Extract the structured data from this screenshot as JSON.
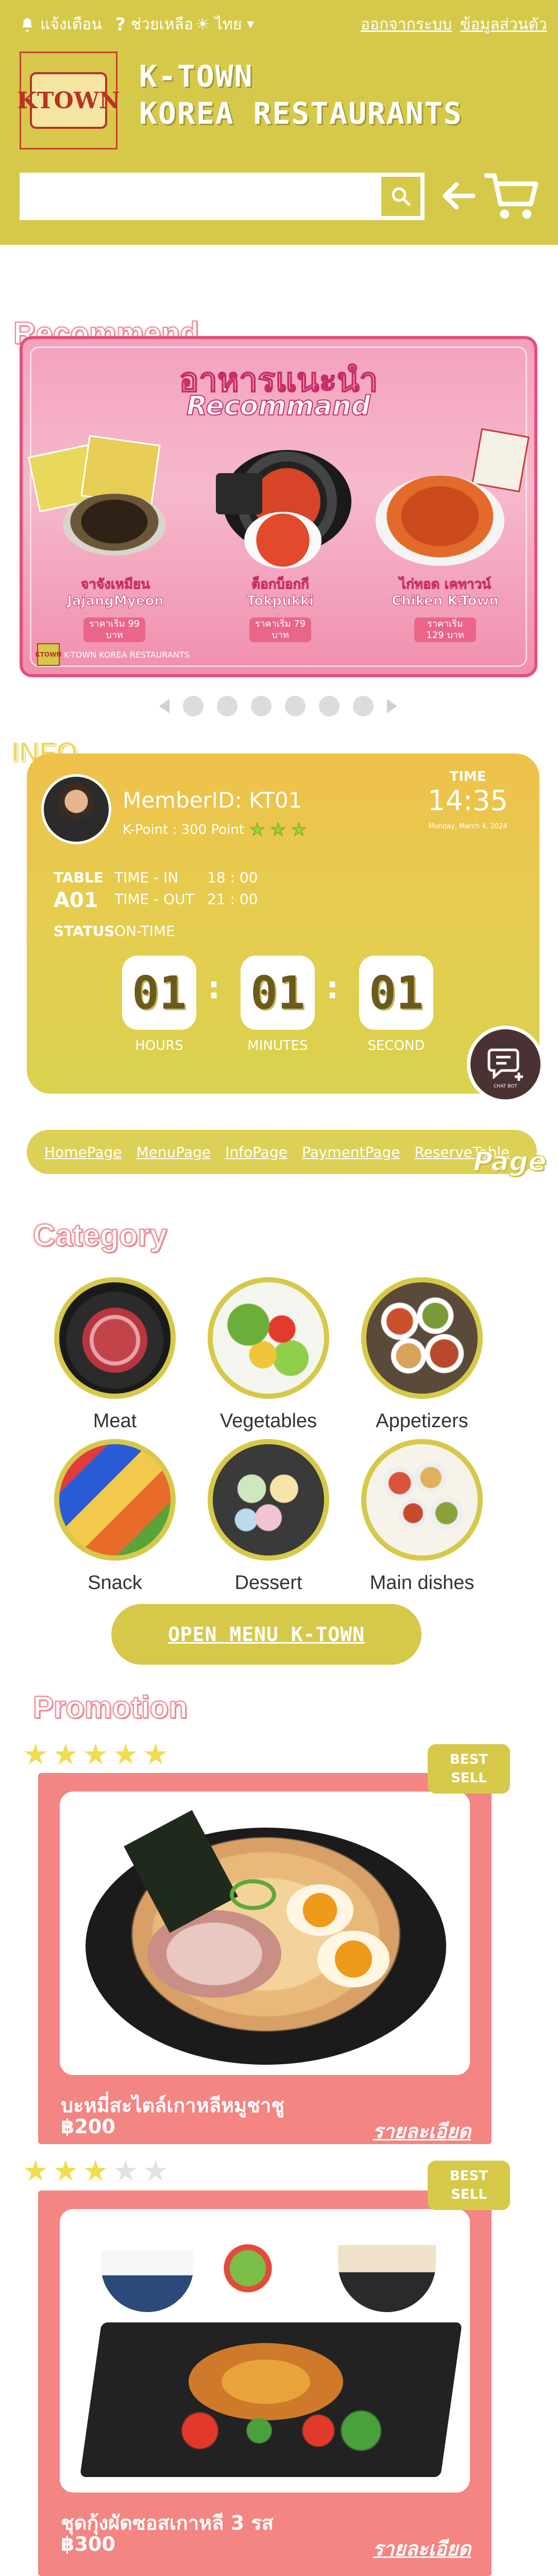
{
  "topbar": {
    "notifications": "แจ้งเตือน",
    "help": "ช่วยเหลือ",
    "language": "ไทย",
    "logout": "ออกจากระบบ",
    "profile": "ข้อมูลส่วนตัว"
  },
  "brand": {
    "logo_text": "KTOWN",
    "name_line1": "K-TOWN",
    "name_line2": "KOREA RESTAURANTS"
  },
  "search": {
    "placeholder": "",
    "value": ""
  },
  "sections": {
    "recommend": "Recommend",
    "info": "INFO",
    "page": "Page",
    "category": "Category",
    "promotion": "Promotion"
  },
  "banner": {
    "title_th": "อาหารแนะนำ",
    "title_en": "Recommand",
    "items": [
      {
        "name_th": "จาจังเหมียน",
        "name_en": "JajangMyeon",
        "price": "ราคาเริ่ม 99 บาท"
      },
      {
        "name_th": "ต็อกบ็อกกี",
        "name_en": "Tokpukki",
        "price": "ราคาเริ่ม 79 บาท"
      },
      {
        "name_th": "ไก่ทอด เคทาวน์",
        "name_en": "Chiken K-Town",
        "price": "ราคาเริ่ม 129 บาท"
      }
    ],
    "footer": "K-TOWN KOREA RESTAURANTS"
  },
  "carousel": {
    "count": 6,
    "active": 0
  },
  "info": {
    "member_id": "MemberID: KT01",
    "kpoint": "K-Point : 300 Point",
    "kpoint_stars": 3,
    "time_label": "TIME",
    "time_value": "14:35",
    "date": "Monday, March 4, 2024",
    "table_label": "TABLE",
    "table_value": "A01",
    "time_in_label": "TIME - IN",
    "time_in_value": "18 : 00",
    "time_out_label": "TIME - OUT",
    "time_out_value": "21 : 00",
    "status_label": "STATUS",
    "status_value": "ON-TIME",
    "counters": [
      {
        "value": "01",
        "label": "HOURS"
      },
      {
        "value": "01",
        "label": "MINUTES"
      },
      {
        "value": "01",
        "label": "SECOND"
      }
    ],
    "chat_label": "CHAT BOT"
  },
  "page_nav": [
    "HomePage",
    "MenuPage",
    "InfoPage",
    "PaymentPage",
    "ReserveTable"
  ],
  "categories": [
    "Meat",
    "Vegetables",
    "Appetizers",
    "Snack",
    "Dessert",
    "Main dishes"
  ],
  "open_menu": "OPEN MENU K-TOWN",
  "promotions": [
    {
      "badge_line1": "BEST",
      "badge_line2": "SELL",
      "rating": 5,
      "name": "บะหมี่สะไตล์เกาหลีหมูชาชู",
      "price": "฿200",
      "detail": "รายละเอียด"
    },
    {
      "badge_line1": "BEST",
      "badge_line2": "SELL",
      "rating": 3,
      "name": "ชุดกุ้งผัดซอสเกาหลี 3 รส",
      "price": "฿300",
      "detail": "รายละเอียด"
    }
  ],
  "colors": {
    "header": "#d6c94a",
    "accent_pink": "#e4507a",
    "promo": "#f38582",
    "star": "#f2dc50"
  }
}
